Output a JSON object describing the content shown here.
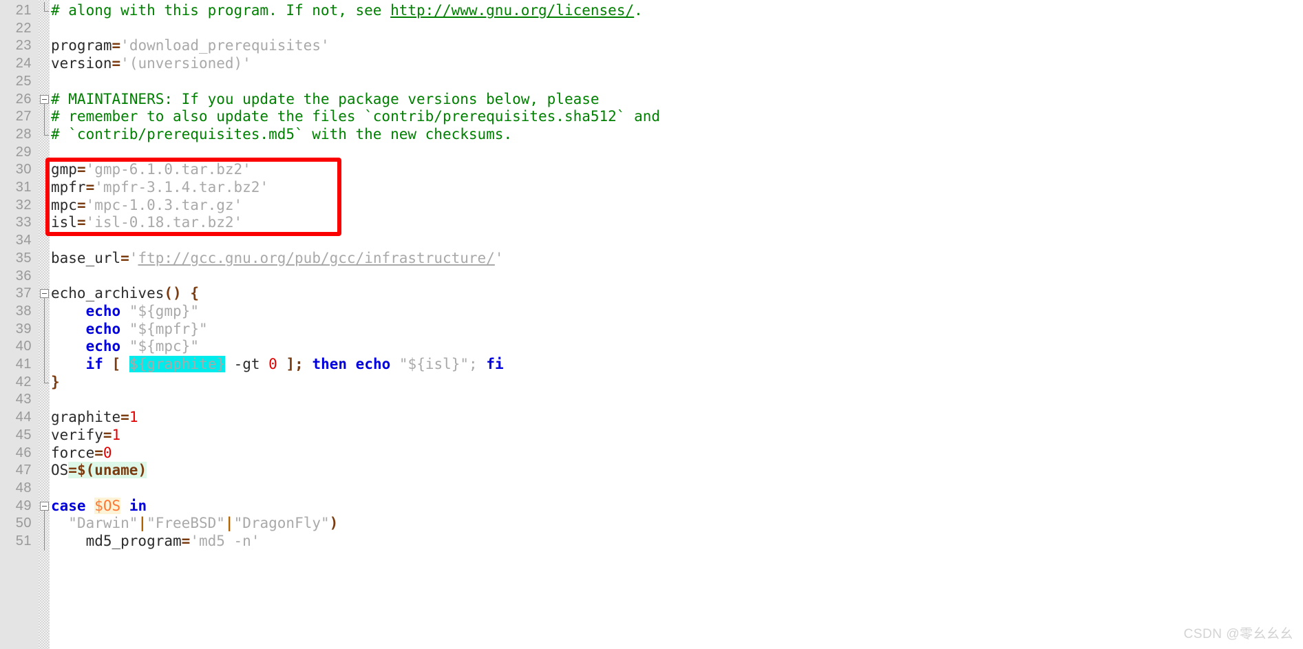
{
  "editor": {
    "language": "shell",
    "first_visible_line": 21,
    "last_visible_line": 51,
    "colors": {
      "comment": "#008000",
      "keyword": "#0000dd",
      "string": "#a9a9a9",
      "operator": "#7a3b10",
      "number": "#e00000",
      "variable_highlight": "#ff7733",
      "gutter_background": "#e4e4e4",
      "line_number": "#999999",
      "annotation_box": "#fb0000",
      "selection_highlight": "#00ecec",
      "occurrence_highlight_mint": "#ddf8e8",
      "occurrence_highlight_cream": "#fdf4d8"
    }
  },
  "lines": [
    {
      "number": "21",
      "fold": "end",
      "tokens": [
        {
          "t": "# along with this program. If not, see ",
          "c": "cmt"
        },
        {
          "t": "http://www.gnu.org/licenses/",
          "c": "cmt-url"
        },
        {
          "t": ".",
          "c": "cmt"
        }
      ]
    },
    {
      "number": "22",
      "tokens": []
    },
    {
      "number": "23",
      "tokens": [
        {
          "t": "program",
          "c": "plain"
        },
        {
          "t": "=",
          "c": "op"
        },
        {
          "t": "'download_prerequisites'",
          "c": "str"
        }
      ]
    },
    {
      "number": "24",
      "tokens": [
        {
          "t": "version",
          "c": "plain"
        },
        {
          "t": "=",
          "c": "op"
        },
        {
          "t": "'(unversioned)'",
          "c": "str"
        }
      ]
    },
    {
      "number": "25",
      "tokens": []
    },
    {
      "number": "26",
      "fold": "start",
      "tokens": [
        {
          "t": "# MAINTAINERS: If you update the package versions below, please",
          "c": "cmt"
        }
      ]
    },
    {
      "number": "27",
      "fold": "mid",
      "tokens": [
        {
          "t": "# remember to also update the files `contrib/prerequisites.sha512` and",
          "c": "cmt"
        }
      ]
    },
    {
      "number": "28",
      "fold": "end",
      "tokens": [
        {
          "t": "# `contrib/prerequisites.md5` with the new checksums.",
          "c": "cmt"
        }
      ]
    },
    {
      "number": "29",
      "tokens": []
    },
    {
      "number": "30",
      "tokens": [
        {
          "t": "gmp",
          "c": "plain"
        },
        {
          "t": "=",
          "c": "op"
        },
        {
          "t": "'gmp-6.1.0.tar.bz2'",
          "c": "str"
        }
      ]
    },
    {
      "number": "31",
      "tokens": [
        {
          "t": "mpfr",
          "c": "plain"
        },
        {
          "t": "=",
          "c": "op"
        },
        {
          "t": "'mpfr-3.1.4.tar.bz2'",
          "c": "str"
        }
      ]
    },
    {
      "number": "32",
      "tokens": [
        {
          "t": "mpc",
          "c": "plain"
        },
        {
          "t": "=",
          "c": "op"
        },
        {
          "t": "'mpc-1.0.3.tar.gz'",
          "c": "str"
        }
      ]
    },
    {
      "number": "33",
      "tokens": [
        {
          "t": "isl",
          "c": "plain"
        },
        {
          "t": "=",
          "c": "op"
        },
        {
          "t": "'isl-0.18.tar.bz2'",
          "c": "str"
        }
      ]
    },
    {
      "number": "34",
      "tokens": []
    },
    {
      "number": "35",
      "tokens": [
        {
          "t": "base_url",
          "c": "plain"
        },
        {
          "t": "=",
          "c": "op"
        },
        {
          "t": "'",
          "c": "str"
        },
        {
          "t": "ftp://gcc.gnu.org/pub/gcc/infrastructure/",
          "c": "str-url"
        },
        {
          "t": "'",
          "c": "str"
        }
      ]
    },
    {
      "number": "36",
      "tokens": []
    },
    {
      "number": "37",
      "fold": "start",
      "tokens": [
        {
          "t": "echo_archives",
          "c": "plain"
        },
        {
          "t": "()",
          "c": "op"
        },
        {
          "t": " ",
          "c": "plain"
        },
        {
          "t": "{",
          "c": "op"
        }
      ]
    },
    {
      "number": "38",
      "fold": "mid",
      "tokens": [
        {
          "t": "    ",
          "c": "plain"
        },
        {
          "t": "echo",
          "c": "kw"
        },
        {
          "t": " ",
          "c": "plain"
        },
        {
          "t": "\"${gmp}\"",
          "c": "str"
        }
      ]
    },
    {
      "number": "39",
      "fold": "mid",
      "tokens": [
        {
          "t": "    ",
          "c": "plain"
        },
        {
          "t": "echo",
          "c": "kw"
        },
        {
          "t": " ",
          "c": "plain"
        },
        {
          "t": "\"${mpfr}\"",
          "c": "str"
        }
      ]
    },
    {
      "number": "40",
      "fold": "mid",
      "tokens": [
        {
          "t": "    ",
          "c": "plain"
        },
        {
          "t": "echo",
          "c": "kw"
        },
        {
          "t": " ",
          "c": "plain"
        },
        {
          "t": "\"${mpc}\"",
          "c": "str"
        }
      ]
    },
    {
      "number": "41",
      "fold": "mid",
      "tokens": [
        {
          "t": "    ",
          "c": "plain"
        },
        {
          "t": "if",
          "c": "kw"
        },
        {
          "t": " ",
          "c": "plain"
        },
        {
          "t": "[",
          "c": "op"
        },
        {
          "t": " ",
          "c": "plain"
        },
        {
          "t": "${graphite}",
          "c": "str hl-cyan"
        },
        {
          "t": " ",
          "c": "plain"
        },
        {
          "t": "-gt",
          "c": "plain"
        },
        {
          "t": " ",
          "c": "plain"
        },
        {
          "t": "0",
          "c": "num"
        },
        {
          "t": " ",
          "c": "plain"
        },
        {
          "t": "];",
          "c": "op"
        },
        {
          "t": " ",
          "c": "plain"
        },
        {
          "t": "then",
          "c": "kw"
        },
        {
          "t": " ",
          "c": "plain"
        },
        {
          "t": "echo",
          "c": "kw"
        },
        {
          "t": " ",
          "c": "plain"
        },
        {
          "t": "\"${isl}\";",
          "c": "str"
        },
        {
          "t": " ",
          "c": "plain"
        },
        {
          "t": "fi",
          "c": "kw"
        }
      ]
    },
    {
      "number": "42",
      "fold": "end",
      "tokens": [
        {
          "t": "}",
          "c": "op"
        }
      ]
    },
    {
      "number": "43",
      "tokens": []
    },
    {
      "number": "44",
      "tokens": [
        {
          "t": "graphite",
          "c": "plain"
        },
        {
          "t": "=",
          "c": "op"
        },
        {
          "t": "1",
          "c": "num"
        }
      ]
    },
    {
      "number": "45",
      "tokens": [
        {
          "t": "verify",
          "c": "plain"
        },
        {
          "t": "=",
          "c": "op"
        },
        {
          "t": "1",
          "c": "num"
        }
      ]
    },
    {
      "number": "46",
      "tokens": [
        {
          "t": "force",
          "c": "plain"
        },
        {
          "t": "=",
          "c": "op"
        },
        {
          "t": "0",
          "c": "num"
        }
      ]
    },
    {
      "number": "47",
      "tokens": [
        {
          "t": "OS",
          "c": "plain"
        },
        {
          "t": "=",
          "c": "op hl-mint"
        },
        {
          "t": "$(uname)",
          "c": "op hl-mint"
        }
      ]
    },
    {
      "number": "48",
      "tokens": []
    },
    {
      "number": "49",
      "fold": "start",
      "tokens": [
        {
          "t": "case",
          "c": "kw"
        },
        {
          "t": " ",
          "c": "plain"
        },
        {
          "t": "$OS",
          "c": "varorange hl-cream"
        },
        {
          "t": " ",
          "c": "plain"
        },
        {
          "t": "in",
          "c": "kw"
        }
      ]
    },
    {
      "number": "50",
      "fold": "mid",
      "tokens": [
        {
          "t": "  ",
          "c": "plain"
        },
        {
          "t": "\"Darwin\"",
          "c": "str"
        },
        {
          "t": "|",
          "c": "pipe"
        },
        {
          "t": "\"FreeBSD\"",
          "c": "str"
        },
        {
          "t": "|",
          "c": "pipe"
        },
        {
          "t": "\"DragonFly\"",
          "c": "str"
        },
        {
          "t": ")",
          "c": "op"
        }
      ]
    },
    {
      "number": "51",
      "fold": "mid",
      "tokens": [
        {
          "t": "    ",
          "c": "plain"
        },
        {
          "t": "md5_program",
          "c": "plain"
        },
        {
          "t": "=",
          "c": "op"
        },
        {
          "t": "'md5 -n'",
          "c": "str"
        }
      ]
    }
  ],
  "annotation": {
    "type": "red-rectangle",
    "covers_lines": [
      "30",
      "31",
      "32",
      "33"
    ],
    "color": "#fb0000"
  },
  "watermark": {
    "text": "CSDN @零幺幺幺"
  }
}
